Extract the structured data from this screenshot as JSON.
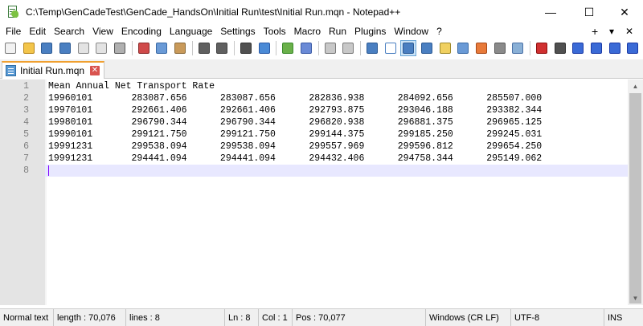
{
  "window": {
    "title": "C:\\Temp\\GenCadeTest\\GenCade_HandsOn\\Initial Run\\test\\Initial Run.mqn - Notepad++",
    "controls": {
      "minimize": "—",
      "maximize": "☐",
      "close": "✕"
    }
  },
  "menu": {
    "items": [
      "File",
      "Edit",
      "Search",
      "View",
      "Encoding",
      "Language",
      "Settings",
      "Tools",
      "Macro",
      "Run",
      "Plugins",
      "Window",
      "?"
    ],
    "right": {
      "plus": "+",
      "dropdown": "▾",
      "close": "✕"
    }
  },
  "toolbar": {
    "icons": [
      {
        "name": "new-file-icon",
        "color": "#f2f2f2",
        "border": "#7a7a7a"
      },
      {
        "name": "open-file-icon",
        "color": "#f3c54a",
        "border": "#b8861b"
      },
      {
        "name": "save-icon",
        "color": "#4a7fc1",
        "border": "#2c5a94"
      },
      {
        "name": "save-all-icon",
        "color": "#4a7fc1",
        "border": "#2c5a94"
      },
      {
        "name": "close-icon",
        "color": "#e3e3e3",
        "border": "#8a8a8a"
      },
      {
        "name": "close-all-icon",
        "color": "#e3e3e3",
        "border": "#8a8a8a"
      },
      {
        "name": "print-icon",
        "color": "#b0b0b0",
        "border": "#5a5a5a"
      },
      {
        "sep": true
      },
      {
        "name": "cut-icon",
        "color": "#d04a4a",
        "border": "#8a2a2a"
      },
      {
        "name": "copy-icon",
        "color": "#6a9ad6",
        "border": "#3a6aa6"
      },
      {
        "name": "paste-icon",
        "color": "#c99a5a",
        "border": "#8a6a3a"
      },
      {
        "sep": true
      },
      {
        "name": "undo-icon",
        "color": "#606060",
        "border": "#404040"
      },
      {
        "name": "redo-icon",
        "color": "#606060",
        "border": "#404040"
      },
      {
        "sep": true
      },
      {
        "name": "find-icon",
        "color": "#505050",
        "border": "#303030"
      },
      {
        "name": "replace-icon",
        "color": "#4a8ad6",
        "border": "#2a5aa6"
      },
      {
        "sep": true
      },
      {
        "name": "zoom-in-icon",
        "color": "#6ab04a",
        "border": "#3a8a2a"
      },
      {
        "name": "zoom-out-icon",
        "color": "#6a8ad6",
        "border": "#3a5aa6"
      },
      {
        "sep": true
      },
      {
        "name": "sync-vertical-icon",
        "color": "#c8c8c8",
        "border": "#7a7a7a"
      },
      {
        "name": "sync-horizontal-icon",
        "color": "#c8c8c8",
        "border": "#7a7a7a"
      },
      {
        "sep": true
      },
      {
        "name": "word-wrap-icon",
        "color": "#4a7fc1",
        "border": "#2c5a94"
      },
      {
        "name": "show-all-chars-icon",
        "color": "#ffffff",
        "border": "#4a7fc1"
      },
      {
        "name": "indent-guide-icon",
        "color": "#4a7fc1",
        "border": "#2c5a94",
        "active": true
      },
      {
        "name": "udl-icon",
        "color": "#4a7fc1",
        "border": "#2c5a94"
      },
      {
        "name": "doc-map-icon",
        "color": "#f0d060",
        "border": "#a08a2a"
      },
      {
        "name": "function-list-icon",
        "color": "#6a9ad6",
        "border": "#3a6aa6"
      },
      {
        "name": "folder-workspace-icon",
        "color": "#e87a3a",
        "border": "#a84a1a"
      },
      {
        "name": "doc-list-icon",
        "color": "#8a8a8a",
        "border": "#5a5a5a"
      },
      {
        "name": "monitor-icon",
        "color": "#8ab0d6",
        "border": "#4a70a6"
      },
      {
        "sep": true
      },
      {
        "name": "record-macro-icon",
        "color": "#d03030",
        "border": "#901010"
      },
      {
        "name": "stop-record-icon",
        "color": "#505050",
        "border": "#303030"
      },
      {
        "name": "play-macro-icon",
        "color": "#3a6ad6",
        "border": "#1a3aa6"
      },
      {
        "name": "run-macro-multiple-icon",
        "color": "#3a6ad6",
        "border": "#1a3aa6"
      },
      {
        "name": "save-macro-icon",
        "color": "#3a6ad6",
        "border": "#1a3aa6"
      },
      {
        "name": "spell-check-icon",
        "color": "#3a6ad6",
        "border": "#1a3aa6"
      }
    ]
  },
  "tab": {
    "label": "Initial Run.mqn",
    "close": "✕"
  },
  "editor": {
    "lines": [
      {
        "num": "1",
        "text": "Mean Annual Net Transport Rate"
      },
      {
        "num": "2",
        "text": "19960101       283087.656      283087.656      282836.938      284092.656      285507.000"
      },
      {
        "num": "3",
        "text": "19970101       292661.406      292661.406      292793.875      293046.188      293382.344"
      },
      {
        "num": "4",
        "text": "19980101       296790.344      296790.344      296820.938      296881.375      296965.125"
      },
      {
        "num": "5",
        "text": "19990101       299121.750      299121.750      299144.375      299185.250      299245.031"
      },
      {
        "num": "6",
        "text": "19991231       299538.094      299538.094      299557.969      299596.812      299654.250"
      },
      {
        "num": "7",
        "text": "19991231       294441.094      294441.094      294432.406      294758.344      295149.062"
      },
      {
        "num": "8",
        "text": "",
        "current": true
      }
    ]
  },
  "scrollbar": {
    "up": "▲",
    "down": "▼"
  },
  "status": {
    "type": "Normal text",
    "length": "length : 70,076",
    "lines": "lines : 8",
    "ln": "Ln : 8",
    "col": "Col : 1",
    "pos": "Pos : 70,077",
    "eol": "Windows (CR LF)",
    "encoding": "UTF-8",
    "mode": "INS"
  }
}
